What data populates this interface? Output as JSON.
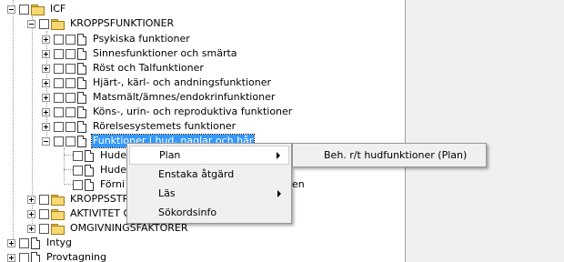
{
  "tree": {
    "root": "ICF",
    "kroppsfunktioner": {
      "label": "KROPPSFUNKTIONER",
      "children": [
        "Psykiska funktioner",
        "Sinnesfunktioner och smärta",
        "Röst och Talfunktioner",
        "Hjärt-, kärl- och andningsfunktioner",
        "Matsmält/ämnes/endokrinfunktioner",
        "Köns-, urin- och reproduktiva funktioner",
        "Rörelsesystemets funktioner",
        "Funktioner i hud, naglar och hår"
      ],
      "sub_children": [
        "Hude",
        "Hude",
        "Förni"
      ],
      "sub_tail_text": "en"
    },
    "kroppsstrukturer_partial": "KROPPSSTRU",
    "aktivitet_partial": "AKTIVITET O",
    "omgivningsfaktorer": "OMGIVNINGSFAKTORER",
    "intyg": "Intyg",
    "provtagning": "Provtagning"
  },
  "context_menu": {
    "items": [
      {
        "label": "Plan",
        "has_submenu": true,
        "hovered": true
      },
      {
        "label": "Enstaka åtgärd",
        "has_submenu": false
      },
      {
        "label": "Läs",
        "has_submenu": true
      },
      {
        "label": "Sökordsinfo",
        "has_submenu": false
      }
    ]
  },
  "submenu": {
    "items": [
      {
        "label": "Beh. r/t hudfunktioner (Plan)"
      }
    ]
  },
  "colors": {
    "selection": "#3399ff",
    "folder": "#f7d871",
    "menu_bg": "#f0f0f0"
  }
}
